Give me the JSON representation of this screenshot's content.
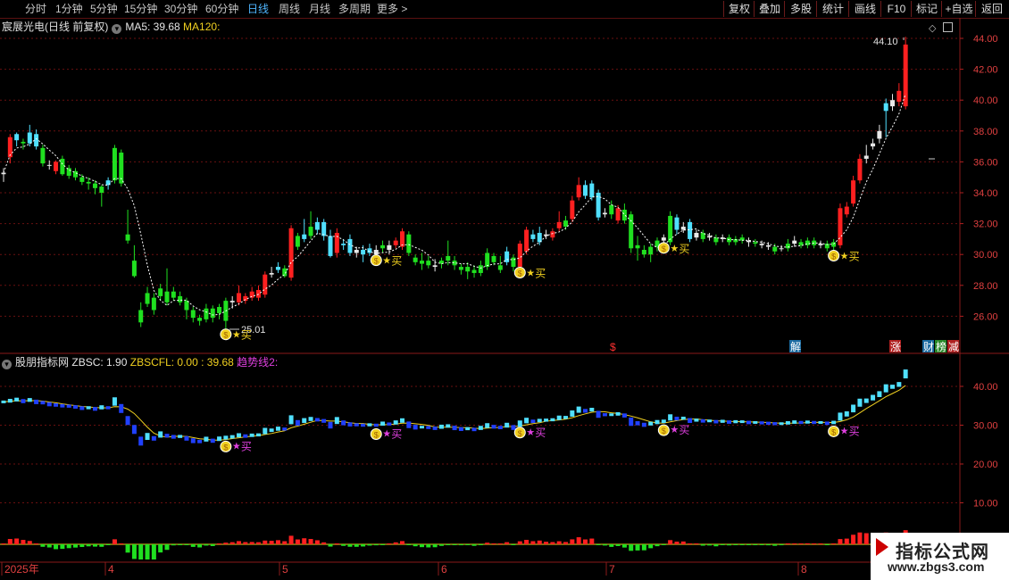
{
  "toolbar": {
    "periods": [
      "分时",
      "1分钟",
      "5分钟",
      "15分钟",
      "30分钟",
      "60分钟",
      "日线",
      "周线",
      "月线",
      "多周期",
      "更多 >"
    ],
    "active_period": "日线",
    "buttons": [
      "复权",
      "叠加",
      "多股",
      "统计",
      "画线",
      "F10",
      "标记",
      "+自选",
      "返回"
    ]
  },
  "main_panel": {
    "stock_name": "宸展光电(日线 前复权)",
    "ma5_label": "MA5: 39.68",
    "ma120_label": "MA120:",
    "high_label": "44.10",
    "low_label": "25.01",
    "y_ticks": [
      "44.00",
      "42.00",
      "40.00",
      "38.00",
      "36.00",
      "34.00",
      "32.00",
      "30.00",
      "28.00",
      "26.00"
    ],
    "buy_label": "买",
    "event_markers": [
      "$",
      "解",
      "涨",
      "财",
      "榜",
      "减"
    ]
  },
  "sub_panel": {
    "indicator_name": "股朋指标网",
    "zbsc": "ZBSC: 1.90",
    "zbscfl": "ZBSCFL: 0.00",
    "zbscfl_extra": ": 39.68",
    "trend_label": "趋势线2:",
    "y_ticks": [
      "40.00",
      "30.00",
      "20.00",
      "10.00"
    ]
  },
  "x_axis": {
    "labels": [
      "2025年",
      "4",
      "5",
      "6",
      "7",
      "8"
    ]
  },
  "watermark": {
    "title": "指标公式网",
    "url": "www.zbgs3.com"
  },
  "colors": {
    "up": "#ff2020",
    "down": "#20e020",
    "cyan": "#50e0ff",
    "blue": "#2040ff",
    "yellow": "#f0d020",
    "magenta": "#e040e0",
    "grid": "#6a1010"
  },
  "chart_data": {
    "type": "candlestick",
    "ylim": [
      24.6,
      44.6
    ],
    "candles": [
      {
        "o": 35.2,
        "c": 35.3,
        "h": 35.6,
        "l": 34.7,
        "s": "w"
      },
      {
        "o": 36.3,
        "c": 37.6,
        "h": 37.8,
        "l": 35.9,
        "s": "r"
      },
      {
        "o": 37.4,
        "c": 37.8,
        "h": 37.9,
        "l": 37.0,
        "s": "c"
      },
      {
        "o": 37.3,
        "c": 37.2,
        "h": 37.5,
        "l": 36.8,
        "s": "g"
      },
      {
        "o": 37.2,
        "c": 37.9,
        "h": 38.4,
        "l": 37.0,
        "s": "c"
      },
      {
        "o": 37.8,
        "c": 37.0,
        "h": 38.1,
        "l": 36.8,
        "s": "c"
      },
      {
        "o": 36.9,
        "c": 35.9,
        "h": 37.1,
        "l": 35.7,
        "s": "g"
      },
      {
        "o": 35.8,
        "c": 35.8,
        "h": 36.1,
        "l": 35.5,
        "s": "w"
      },
      {
        "o": 36.0,
        "c": 35.4,
        "h": 36.1,
        "l": 35.2,
        "s": "r"
      },
      {
        "o": 36.2,
        "c": 35.2,
        "h": 36.4,
        "l": 35.1,
        "s": "g"
      },
      {
        "o": 35.6,
        "c": 35.1,
        "h": 35.8,
        "l": 34.9,
        "s": "g"
      },
      {
        "o": 35.4,
        "c": 35.0,
        "h": 35.6,
        "l": 34.8,
        "s": "g"
      },
      {
        "o": 35.0,
        "c": 34.7,
        "h": 35.2,
        "l": 34.5,
        "s": "g"
      },
      {
        "o": 34.7,
        "c": 34.6,
        "h": 35.0,
        "l": 34.2,
        "s": "g"
      },
      {
        "o": 34.6,
        "c": 34.3,
        "h": 34.8,
        "l": 33.9,
        "s": "g"
      },
      {
        "o": 34.4,
        "c": 34.0,
        "h": 34.5,
        "l": 33.1,
        "s": "g"
      },
      {
        "o": 34.5,
        "c": 34.8,
        "h": 35.0,
        "l": 34.2,
        "s": "c"
      },
      {
        "o": 34.8,
        "c": 36.9,
        "h": 37.1,
        "l": 34.6,
        "s": "g"
      },
      {
        "o": 36.6,
        "c": 34.6,
        "h": 36.8,
        "l": 34.4,
        "s": "g"
      },
      {
        "o": 31.3,
        "c": 30.9,
        "h": 32.9,
        "l": 30.7,
        "s": "g"
      },
      {
        "o": 29.6,
        "c": 28.6,
        "h": 30.6,
        "l": 28.5,
        "s": "g"
      },
      {
        "o": 26.4,
        "c": 25.6,
        "h": 26.9,
        "l": 25.3,
        "s": "g"
      },
      {
        "o": 27.5,
        "c": 26.8,
        "h": 27.9,
        "l": 26.6,
        "s": "g"
      },
      {
        "o": 27.2,
        "c": 26.4,
        "h": 27.5,
        "l": 26.1,
        "s": "g"
      },
      {
        "o": 27.3,
        "c": 27.8,
        "h": 28.1,
        "l": 27.0,
        "s": "g"
      },
      {
        "o": 27.6,
        "c": 26.9,
        "h": 29.1,
        "l": 26.7,
        "s": "g"
      },
      {
        "o": 27.6,
        "c": 27.2,
        "h": 27.9,
        "l": 27.0,
        "s": "g"
      },
      {
        "o": 27.3,
        "c": 26.9,
        "h": 27.6,
        "l": 26.7,
        "s": "g"
      },
      {
        "o": 27.0,
        "c": 26.4,
        "h": 27.2,
        "l": 25.8,
        "s": "g"
      },
      {
        "o": 26.4,
        "c": 25.9,
        "h": 26.6,
        "l": 25.6,
        "s": "g"
      },
      {
        "o": 25.9,
        "c": 25.7,
        "h": 26.1,
        "l": 25.4,
        "s": "g"
      },
      {
        "o": 25.8,
        "c": 26.5,
        "h": 26.8,
        "l": 25.6,
        "s": "g"
      },
      {
        "o": 26.5,
        "c": 25.9,
        "h": 26.7,
        "l": 25.6,
        "s": "g"
      },
      {
        "o": 26.2,
        "c": 26.6,
        "h": 26.8,
        "l": 25.8,
        "s": "g"
      },
      {
        "o": 25.7,
        "c": 27.0,
        "h": 27.2,
        "l": 25.0,
        "s": "g"
      },
      {
        "o": 26.9,
        "c": 27.0,
        "h": 27.3,
        "l": 26.5,
        "s": "w"
      },
      {
        "o": 26.9,
        "c": 27.5,
        "h": 28.0,
        "l": 26.7,
        "s": "r"
      },
      {
        "o": 27.0,
        "c": 27.3,
        "h": 27.5,
        "l": 26.8,
        "s": "r"
      },
      {
        "o": 27.2,
        "c": 27.6,
        "h": 27.9,
        "l": 27.0,
        "s": "r"
      },
      {
        "o": 27.2,
        "c": 27.7,
        "h": 28.0,
        "l": 27.0,
        "s": "r"
      },
      {
        "o": 27.4,
        "c": 28.7,
        "h": 28.9,
        "l": 27.2,
        "s": "r"
      },
      {
        "o": 28.7,
        "c": 28.8,
        "h": 29.2,
        "l": 28.5,
        "s": "w"
      },
      {
        "o": 29.0,
        "c": 29.2,
        "h": 29.5,
        "l": 28.8,
        "s": "c"
      },
      {
        "o": 28.6,
        "c": 29.1,
        "h": 29.3,
        "l": 28.5,
        "s": "g"
      },
      {
        "o": 28.5,
        "c": 31.7,
        "h": 31.9,
        "l": 28.3,
        "s": "r"
      },
      {
        "o": 31.2,
        "c": 30.5,
        "h": 31.4,
        "l": 30.3,
        "s": "g"
      },
      {
        "o": 31.0,
        "c": 31.3,
        "h": 32.3,
        "l": 30.8,
        "s": "c"
      },
      {
        "o": 31.2,
        "c": 31.8,
        "h": 32.8,
        "l": 31.0,
        "s": "g"
      },
      {
        "o": 32.1,
        "c": 31.6,
        "h": 32.4,
        "l": 31.3,
        "s": "c"
      },
      {
        "o": 32.1,
        "c": 31.2,
        "h": 32.3,
        "l": 30.9,
        "s": "c"
      },
      {
        "o": 31.2,
        "c": 29.9,
        "h": 31.6,
        "l": 29.8,
        "s": "c"
      },
      {
        "o": 30.1,
        "c": 31.4,
        "h": 31.7,
        "l": 29.8,
        "s": "r"
      },
      {
        "o": 30.7,
        "c": 30.6,
        "h": 31.0,
        "l": 30.3,
        "s": "c"
      },
      {
        "o": 31.0,
        "c": 30.1,
        "h": 31.3,
        "l": 29.9,
        "s": "c"
      },
      {
        "o": 30.3,
        "c": 30.1,
        "h": 30.5,
        "l": 29.8,
        "s": "w"
      },
      {
        "o": 30.3,
        "c": 30.0,
        "h": 30.6,
        "l": 29.5,
        "s": "c"
      },
      {
        "o": 30.4,
        "c": 30.1,
        "h": 30.7,
        "l": 29.9,
        "s": "c"
      },
      {
        "o": 30.3,
        "c": 30.0,
        "h": 30.6,
        "l": 29.8,
        "s": "w"
      },
      {
        "o": 30.6,
        "c": 30.4,
        "h": 30.9,
        "l": 30.1,
        "s": "g"
      },
      {
        "o": 30.6,
        "c": 30.3,
        "h": 30.9,
        "l": 30.0,
        "s": "w"
      },
      {
        "o": 30.6,
        "c": 30.9,
        "h": 31.1,
        "l": 30.4,
        "s": "r"
      },
      {
        "o": 30.5,
        "c": 31.5,
        "h": 31.7,
        "l": 30.3,
        "s": "r"
      },
      {
        "o": 31.3,
        "c": 30.1,
        "h": 31.5,
        "l": 29.9,
        "s": "g"
      },
      {
        "o": 29.8,
        "c": 29.5,
        "h": 30.0,
        "l": 29.3,
        "s": "g"
      },
      {
        "o": 29.6,
        "c": 29.4,
        "h": 30.1,
        "l": 29.0,
        "s": "g"
      },
      {
        "o": 29.6,
        "c": 29.3,
        "h": 29.9,
        "l": 29.1,
        "s": "g"
      },
      {
        "o": 29.3,
        "c": 29.2,
        "h": 29.7,
        "l": 28.9,
        "s": "w"
      },
      {
        "o": 29.4,
        "c": 29.6,
        "h": 29.8,
        "l": 29.1,
        "s": "g"
      },
      {
        "o": 29.6,
        "c": 29.9,
        "h": 30.9,
        "l": 29.3,
        "s": "g"
      },
      {
        "o": 29.6,
        "c": 29.3,
        "h": 29.9,
        "l": 29.0,
        "s": "g"
      },
      {
        "o": 29.2,
        "c": 29.0,
        "h": 29.4,
        "l": 28.7,
        "s": "g"
      },
      {
        "o": 28.9,
        "c": 29.2,
        "h": 29.5,
        "l": 28.4,
        "s": "g"
      },
      {
        "o": 29.0,
        "c": 28.8,
        "h": 29.3,
        "l": 28.5,
        "s": "g"
      },
      {
        "o": 28.8,
        "c": 29.3,
        "h": 29.6,
        "l": 28.6,
        "s": "g"
      },
      {
        "o": 29.2,
        "c": 30.1,
        "h": 30.4,
        "l": 29.0,
        "s": "g"
      },
      {
        "o": 29.9,
        "c": 29.5,
        "h": 30.1,
        "l": 29.3,
        "s": "g"
      },
      {
        "o": 29.0,
        "c": 29.3,
        "h": 29.9,
        "l": 28.8,
        "s": "g"
      },
      {
        "o": 29.5,
        "c": 30.2,
        "h": 30.5,
        "l": 29.3,
        "s": "c"
      },
      {
        "o": 29.8,
        "c": 29.2,
        "h": 30.0,
        "l": 28.9,
        "s": "g"
      },
      {
        "o": 29.2,
        "c": 30.7,
        "h": 30.9,
        "l": 29.0,
        "s": "r"
      },
      {
        "o": 30.2,
        "c": 31.6,
        "h": 31.8,
        "l": 30.0,
        "s": "r"
      },
      {
        "o": 31.3,
        "c": 31.0,
        "h": 31.6,
        "l": 30.8,
        "s": "c"
      },
      {
        "o": 30.8,
        "c": 31.4,
        "h": 31.8,
        "l": 30.6,
        "s": "c"
      },
      {
        "o": 31.2,
        "c": 31.3,
        "h": 31.6,
        "l": 31.0,
        "s": "w"
      },
      {
        "o": 31.1,
        "c": 31.5,
        "h": 31.7,
        "l": 30.9,
        "s": "r"
      },
      {
        "o": 31.7,
        "c": 32.1,
        "h": 32.8,
        "l": 31.5,
        "s": "r"
      },
      {
        "o": 31.8,
        "c": 32.2,
        "h": 32.5,
        "l": 31.6,
        "s": "g"
      },
      {
        "o": 32.3,
        "c": 33.5,
        "h": 33.8,
        "l": 32.1,
        "s": "r"
      },
      {
        "o": 33.7,
        "c": 34.5,
        "h": 35.0,
        "l": 33.5,
        "s": "r"
      },
      {
        "o": 34.5,
        "c": 33.8,
        "h": 34.8,
        "l": 33.6,
        "s": "c"
      },
      {
        "o": 33.7,
        "c": 34.6,
        "h": 34.8,
        "l": 33.5,
        "s": "c"
      },
      {
        "o": 34.0,
        "c": 32.4,
        "h": 34.2,
        "l": 32.2,
        "s": "c"
      },
      {
        "o": 32.6,
        "c": 32.7,
        "h": 33.0,
        "l": 32.4,
        "s": "w"
      },
      {
        "o": 33.2,
        "c": 32.6,
        "h": 33.5,
        "l": 32.3,
        "s": "g"
      },
      {
        "o": 32.2,
        "c": 33.0,
        "h": 33.2,
        "l": 32.0,
        "s": "r"
      },
      {
        "o": 32.9,
        "c": 32.2,
        "h": 33.3,
        "l": 32.0,
        "s": "g"
      },
      {
        "o": 32.6,
        "c": 30.4,
        "h": 32.8,
        "l": 30.1,
        "s": "g"
      },
      {
        "o": 30.6,
        "c": 30.4,
        "h": 31.2,
        "l": 29.6,
        "s": "g"
      },
      {
        "o": 30.3,
        "c": 30.0,
        "h": 30.6,
        "l": 29.8,
        "s": "g"
      },
      {
        "o": 30.0,
        "c": 30.5,
        "h": 30.7,
        "l": 29.5,
        "s": "g"
      },
      {
        "o": 30.5,
        "c": 30.9,
        "h": 31.1,
        "l": 30.2,
        "s": "g"
      },
      {
        "o": 30.9,
        "c": 31.1,
        "h": 31.3,
        "l": 30.6,
        "s": "w"
      },
      {
        "o": 30.8,
        "c": 32.5,
        "h": 32.8,
        "l": 30.6,
        "s": "g"
      },
      {
        "o": 32.4,
        "c": 31.6,
        "h": 32.6,
        "l": 31.3,
        "s": "c"
      },
      {
        "o": 31.6,
        "c": 31.8,
        "h": 32.1,
        "l": 31.4,
        "s": "w"
      },
      {
        "o": 32.1,
        "c": 31.0,
        "h": 32.3,
        "l": 30.8,
        "s": "c"
      },
      {
        "o": 31.1,
        "c": 31.4,
        "h": 31.6,
        "l": 30.9,
        "s": "w"
      },
      {
        "o": 31.4,
        "c": 31.0,
        "h": 31.6,
        "l": 30.8,
        "s": "g"
      },
      {
        "o": 31.2,
        "c": 31.1,
        "h": 31.4,
        "l": 30.9,
        "s": "w"
      },
      {
        "o": 31.1,
        "c": 30.8,
        "h": 31.3,
        "l": 30.6,
        "s": "g"
      },
      {
        "o": 31.0,
        "c": 31.1,
        "h": 31.3,
        "l": 30.8,
        "s": "w"
      },
      {
        "o": 31.1,
        "c": 30.8,
        "h": 31.3,
        "l": 30.6,
        "s": "g"
      },
      {
        "o": 30.8,
        "c": 31.0,
        "h": 31.2,
        "l": 30.6,
        "s": "g"
      },
      {
        "o": 31.1,
        "c": 30.9,
        "h": 31.3,
        "l": 30.7,
        "s": "g"
      },
      {
        "o": 30.9,
        "c": 30.8,
        "h": 31.1,
        "l": 30.5,
        "s": "w"
      },
      {
        "o": 30.8,
        "c": 30.7,
        "h": 31.0,
        "l": 30.5,
        "s": "g"
      },
      {
        "o": 30.7,
        "c": 30.6,
        "h": 30.9,
        "l": 30.4,
        "s": "w"
      },
      {
        "o": 30.6,
        "c": 30.5,
        "h": 30.8,
        "l": 30.3,
        "s": "w"
      },
      {
        "o": 30.5,
        "c": 30.2,
        "h": 30.7,
        "l": 30.0,
        "s": "g"
      },
      {
        "o": 30.4,
        "c": 30.4,
        "h": 30.6,
        "l": 30.2,
        "s": "w"
      },
      {
        "o": 30.4,
        "c": 30.7,
        "h": 31.0,
        "l": 30.2,
        "s": "g"
      },
      {
        "o": 30.7,
        "c": 30.9,
        "h": 31.2,
        "l": 30.5,
        "s": "w"
      },
      {
        "o": 30.8,
        "c": 30.6,
        "h": 31.0,
        "l": 30.4,
        "s": "g"
      },
      {
        "o": 30.6,
        "c": 30.9,
        "h": 31.1,
        "l": 30.4,
        "s": "g"
      },
      {
        "o": 30.9,
        "c": 30.6,
        "h": 31.1,
        "l": 30.4,
        "s": "g"
      },
      {
        "o": 30.6,
        "c": 30.7,
        "h": 30.9,
        "l": 30.4,
        "s": "w"
      },
      {
        "o": 30.7,
        "c": 30.4,
        "h": 30.9,
        "l": 30.2,
        "s": "g"
      },
      {
        "o": 30.5,
        "c": 30.8,
        "h": 31.0,
        "l": 30.1,
        "s": "g"
      },
      {
        "o": 30.6,
        "c": 33.0,
        "h": 33.3,
        "l": 30.4,
        "s": "r"
      },
      {
        "o": 32.6,
        "c": 33.1,
        "h": 33.4,
        "l": 32.4,
        "s": "r"
      },
      {
        "o": 33.3,
        "c": 34.8,
        "h": 35.1,
        "l": 33.1,
        "s": "r"
      },
      {
        "o": 34.8,
        "c": 36.2,
        "h": 36.5,
        "l": 34.6,
        "s": "r"
      },
      {
        "o": 36.2,
        "c": 36.4,
        "h": 37.1,
        "l": 35.9,
        "s": "w"
      },
      {
        "o": 37.0,
        "c": 37.2,
        "h": 37.5,
        "l": 36.8,
        "s": "w"
      },
      {
        "o": 37.5,
        "c": 38.0,
        "h": 38.4,
        "l": 37.2,
        "s": "w"
      },
      {
        "o": 39.3,
        "c": 39.8,
        "h": 40.1,
        "l": 37.6,
        "s": "c"
      },
      {
        "o": 39.6,
        "c": 40.0,
        "h": 40.4,
        "l": 39.3,
        "s": "w"
      },
      {
        "o": 39.9,
        "c": 40.6,
        "h": 41.1,
        "l": 39.6,
        "s": "r"
      },
      {
        "o": 39.6,
        "c": 43.6,
        "h": 44.1,
        "l": 39.4,
        "s": "r"
      }
    ],
    "sub_values": [
      36.0,
      36.3,
      36.6,
      36.2,
      36.5,
      36.0,
      35.8,
      35.4,
      35.2,
      35.0,
      34.9,
      34.7,
      34.4,
      34.5,
      34.2,
      34.6,
      34.5,
      36.1,
      34.3,
      31.2,
      28.9,
      25.9,
      27.1,
      26.6,
      27.6,
      27.3,
      27.0,
      27.1,
      26.6,
      26.0,
      25.8,
      26.4,
      26.0,
      26.5,
      26.8,
      27.0,
      27.4,
      27.2,
      27.4,
      27.5,
      28.5,
      28.7,
      29.1,
      29.0,
      31.4,
      30.6,
      31.2,
      31.6,
      31.4,
      31.1,
      30.0,
      31.2,
      30.6,
      30.2,
      30.1,
      30.0,
      30.1,
      30.0,
      30.4,
      30.3,
      30.7,
      31.2,
      30.1,
      29.5,
      29.5,
      29.4,
      29.2,
      29.6,
      29.8,
      29.3,
      29.0,
      29.1,
      28.9,
      29.3,
      29.9,
      29.6,
      29.4,
      30.0,
      29.4,
      30.4,
      31.2,
      31.0,
      31.2,
      31.3,
      31.4,
      31.9,
      32.0,
      33.0,
      34.0,
      33.7,
      34.0,
      32.8,
      32.7,
      32.7,
      32.9,
      32.5,
      30.9,
      30.5,
      30.1,
      30.4,
      30.8,
      31.0,
      32.0,
      31.7,
      31.8,
      31.2,
      31.3,
      31.1,
      31.1,
      30.9,
      31.0,
      30.8,
      30.9,
      30.9,
      30.7,
      30.7,
      30.6,
      30.5,
      30.4,
      30.4,
      30.6,
      30.8,
      30.7,
      30.8,
      30.7,
      30.7,
      30.5,
      30.7,
      32.2,
      32.9,
      34.3,
      35.8,
      36.3,
      37.1,
      38.0,
      39.5,
      39.9,
      40.5,
      43.2
    ],
    "buy_signals": [
      34,
      57,
      79,
      101,
      127
    ]
  }
}
